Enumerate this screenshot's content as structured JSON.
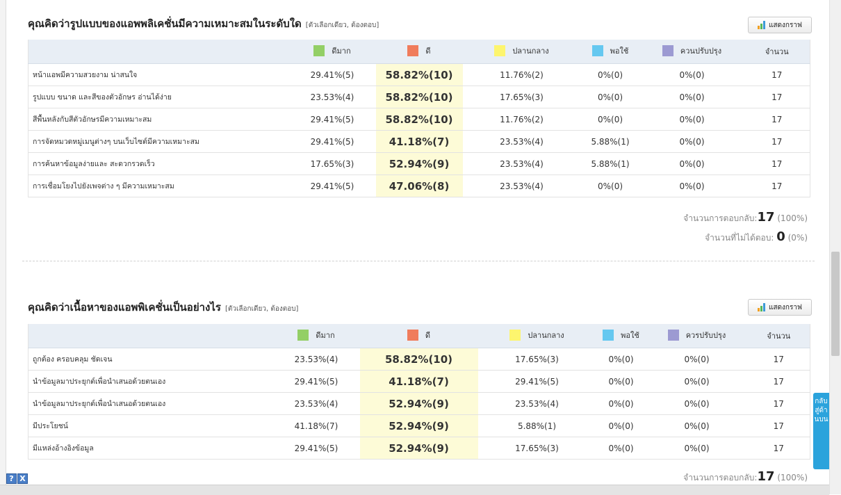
{
  "columns": [
    "ดีมาก",
    "ดี",
    "ปลานกลาง",
    "พอใช้",
    "ควนปรับปรุง",
    "จำนวน"
  ],
  "columns_q2": [
    "ดีมาก",
    "ดี",
    "ปลานกลาง",
    "พอใช้",
    "ควรปรับปรุง",
    "จำนวน"
  ],
  "colors": {
    "ดีมาก": "#93cf66",
    "ดี": "#f07c5c",
    "ปลานกลาง": "#fdf56e",
    "พอใช้": "#65c8f0",
    "ควนปรับปรุง": "#9c9ad2"
  },
  "graph_button_label": "แสดงกราฟ",
  "q1": {
    "title": "คุณคิดว่ารูปแบบของแอพพลิเคชั่นมีความเหมาะสมในระดับใด",
    "hint": "[ตัวเลือกเดียว, ต้องตอบ]",
    "rows": [
      {
        "label": "หน้าแอพมีความสวยงาม น่าสนใจ",
        "values": [
          "29.41%(5)",
          "58.82%(10)",
          "11.76%(2)",
          "0%(0)",
          "0%(0)",
          "17"
        ]
      },
      {
        "label": "รูปแบบ ขนาด และสีของตัวอักษร อ่านได้ง่าย",
        "values": [
          "23.53%(4)",
          "58.82%(10)",
          "17.65%(3)",
          "0%(0)",
          "0%(0)",
          "17"
        ]
      },
      {
        "label": "สีพื้นหลังกับสีตัวอักษรมีความเหมาะสม",
        "values": [
          "29.41%(5)",
          "58.82%(10)",
          "11.76%(2)",
          "0%(0)",
          "0%(0)",
          "17"
        ]
      },
      {
        "label": "การจัดหมวดหมู่เมนูต่างๆ บนเว็บไซต์มีความเหมาะสม",
        "values": [
          "29.41%(5)",
          "41.18%(7)",
          "23.53%(4)",
          "5.88%(1)",
          "0%(0)",
          "17"
        ]
      },
      {
        "label": "การค้นหาข้อมูลง่ายและ สะดวกรวดเร็ว",
        "values": [
          "17.65%(3)",
          "52.94%(9)",
          "23.53%(4)",
          "5.88%(1)",
          "0%(0)",
          "17"
        ]
      },
      {
        "label": "การเชื่อมโยงไปยังเพจต่าง ๆ มีความเหมาะสม",
        "values": [
          "29.41%(5)",
          "47.06%(8)",
          "23.53%(4)",
          "0%(0)",
          "0%(0)",
          "17"
        ]
      }
    ],
    "responses_label": "จำนวนการตอบกลับ:",
    "responses_value": "17",
    "responses_pct": "(100%)",
    "no_answer_label": "จำนวนที่ไม่ได้ตอบ:",
    "no_answer_value": "0",
    "no_answer_pct": "(0%)"
  },
  "q2": {
    "title": "คุณคิดว่าเนื้อหาของแอพพิเคชั่นเป็นอย่างไร",
    "hint": "[ตัวเลือกเดียว, ต้องตอบ]",
    "rows": [
      {
        "label": "ถูกต้อง ครอบคลุม ชัดเจน",
        "values": [
          "23.53%(4)",
          "58.82%(10)",
          "17.65%(3)",
          "0%(0)",
          "0%(0)",
          "17"
        ]
      },
      {
        "label": "นำข้อมูลมาประยุกต์เพื่อนำเสนอด้วยตนเอง",
        "values": [
          "29.41%(5)",
          "41.18%(7)",
          "29.41%(5)",
          "0%(0)",
          "0%(0)",
          "17"
        ]
      },
      {
        "label": "นำข้อมูลมาประยุกต์เพื่อนำเสนอด้วยตนเอง",
        "values": [
          "23.53%(4)",
          "52.94%(9)",
          "23.53%(4)",
          "0%(0)",
          "0%(0)",
          "17"
        ]
      },
      {
        "label": "มีประโยชน์",
        "values": [
          "41.18%(7)",
          "52.94%(9)",
          "5.88%(1)",
          "0%(0)",
          "0%(0)",
          "17"
        ]
      },
      {
        "label": "มีแหล่งอ้างอิงข้อมูล",
        "values": [
          "29.41%(5)",
          "52.94%(9)",
          "17.65%(3)",
          "0%(0)",
          "0%(0)",
          "17"
        ]
      }
    ],
    "responses_label": "จำนวนการตอบกลับ:",
    "responses_value": "17",
    "responses_pct": "(100%)"
  },
  "back_to_top": "กลับสู่ด้านบน",
  "help_icons": [
    "?",
    "X"
  ]
}
